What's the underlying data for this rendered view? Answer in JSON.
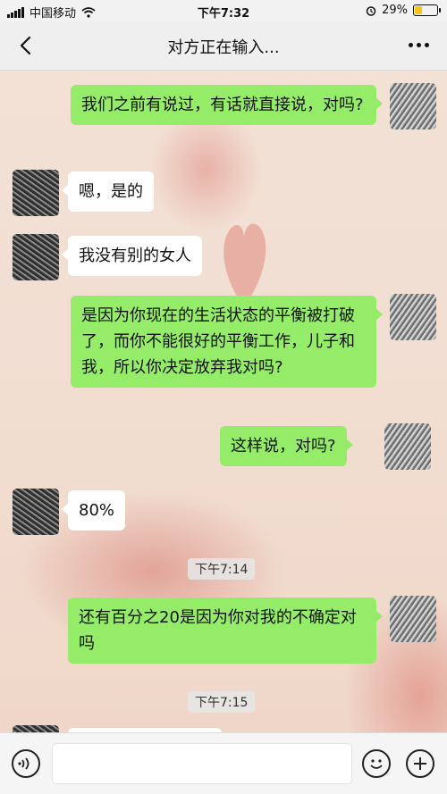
{
  "status_bar": {
    "carrier": "中国移动",
    "time": "下午7:32",
    "battery_percent": "29%",
    "battery_level": 0.29,
    "battery_color": "#f5c518",
    "icons": [
      "signal-icon",
      "wifi-icon",
      "alarm-icon",
      "battery-icon"
    ]
  },
  "nav": {
    "back_icon": "chevron-left-icon",
    "title": "对方正在输入...",
    "more_icon": "more-dots-icon"
  },
  "messages": [
    {
      "side": "me",
      "text": "我们之前有说过，有话就直接说，对吗?"
    },
    {
      "side": "them",
      "text": "嗯，是的"
    },
    {
      "side": "them",
      "text": "我没有别的女人"
    },
    {
      "side": "me",
      "text": "是因为你现在的生活状态的平衡被打破了，而你不能很好的平衡工作，儿子和我，所以你决定放弃我对吗?"
    },
    {
      "side": "me",
      "text": "这样说，对吗?"
    },
    {
      "side": "them",
      "text": "80%"
    },
    {
      "side": "time",
      "text": "下午7:14"
    },
    {
      "side": "me",
      "text": "还有百分之20是因为你对我的不确定对吗"
    },
    {
      "side": "time",
      "text": "下午7:15"
    }
  ],
  "colors": {
    "my_bubble": "#95ec69",
    "their_bubble": "#ffffff",
    "chat_background": "#f4e3d7"
  },
  "bottom_bar": {
    "voice_icon": "voice-icon",
    "emoji_icon": "emoji-icon",
    "plus_icon": "plus-icon",
    "input_value": ""
  }
}
